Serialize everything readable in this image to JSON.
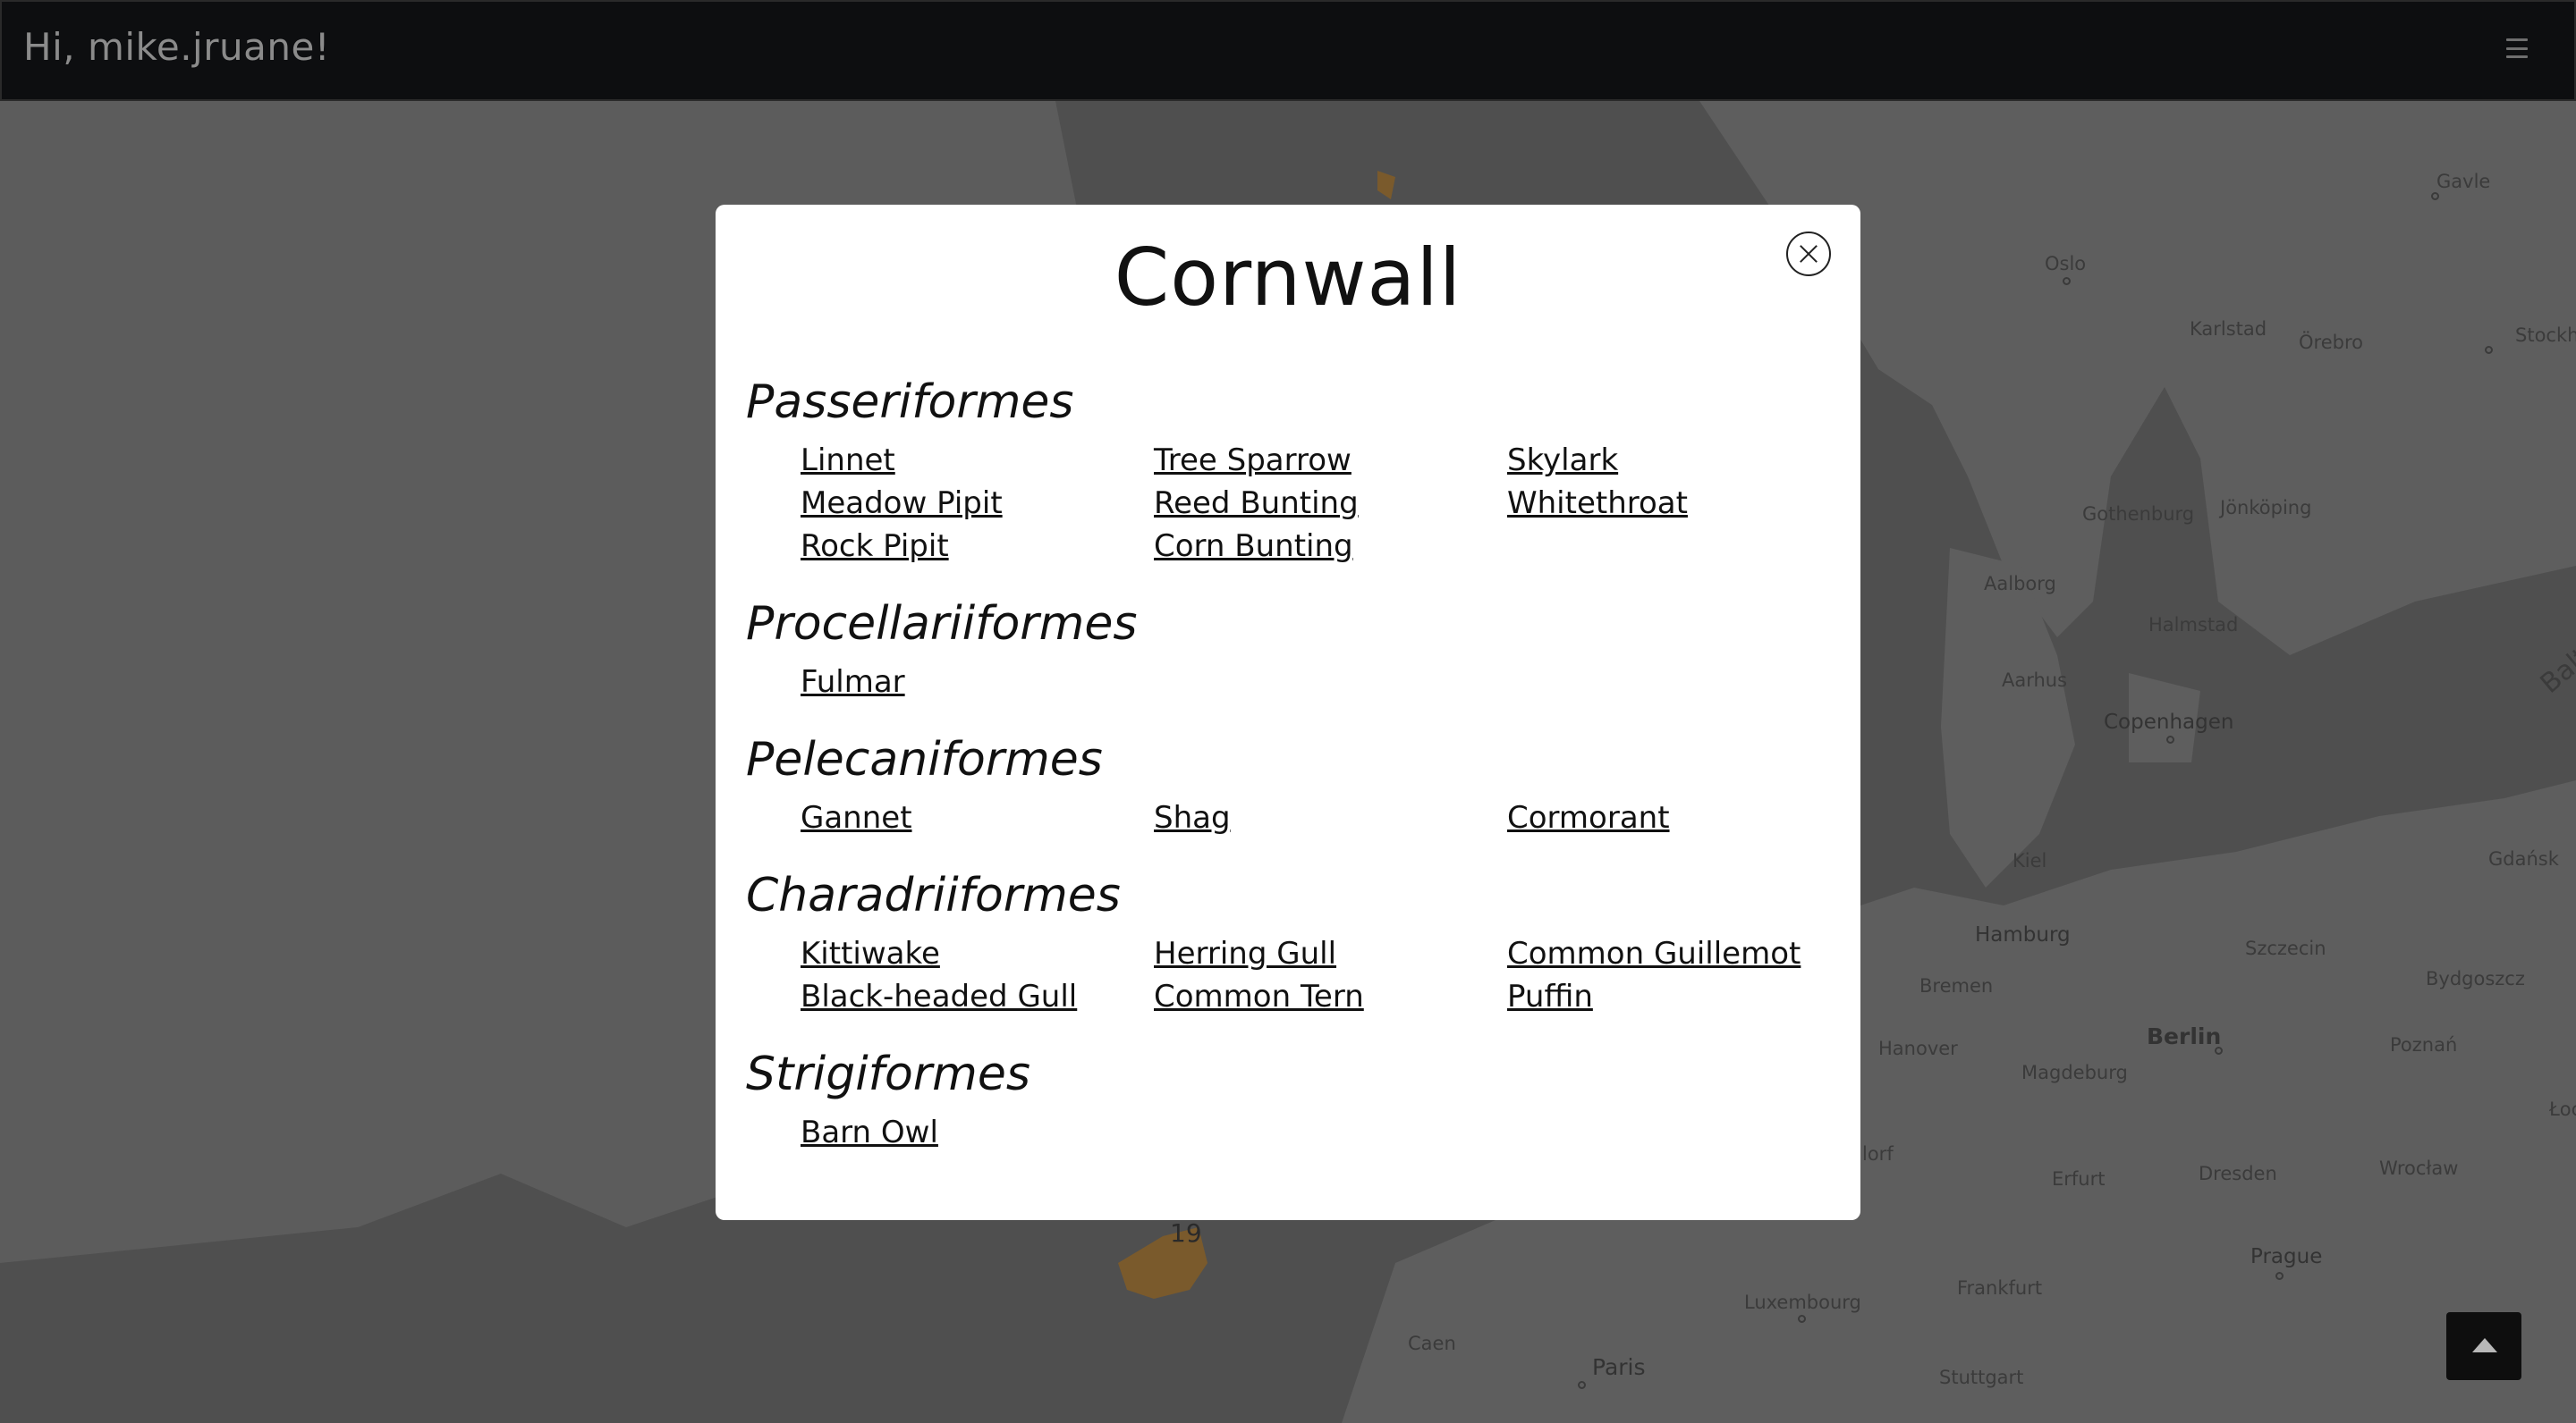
{
  "header": {
    "greeting": "Hi, mike.jruane!",
    "menu_icon": "hamburger-menu-icon"
  },
  "map": {
    "labels": [
      {
        "name": "Gavle",
        "text": "Gavle"
      },
      {
        "name": "Oslo",
        "text": "Oslo"
      },
      {
        "name": "Karlstad",
        "text": "Karlstad"
      },
      {
        "name": "Orebro",
        "text": "Örebro"
      },
      {
        "name": "Stockholm",
        "text": "Stockho"
      },
      {
        "name": "Gothenburg",
        "text": "Gothenburg"
      },
      {
        "name": "Jonkoping",
        "text": "Jönköping"
      },
      {
        "name": "Aalborg",
        "text": "Aalborg"
      },
      {
        "name": "Halmstad",
        "text": "Halmstad"
      },
      {
        "name": "Aarhus",
        "text": "Aarhus"
      },
      {
        "name": "Copenhagen",
        "text": "Copenhagen"
      },
      {
        "name": "Baltic",
        "text": "Balt"
      },
      {
        "name": "Kiel",
        "text": "Kiel"
      },
      {
        "name": "Gdansk",
        "text": "Gdańsk"
      },
      {
        "name": "Hamburg",
        "text": "Hamburg"
      },
      {
        "name": "Szczecin",
        "text": "Szczecin"
      },
      {
        "name": "Bremen",
        "text": "Bremen"
      },
      {
        "name": "Bydgoszcz",
        "text": "Bydgoszcz"
      },
      {
        "name": "Berlin",
        "text": "Berlin"
      },
      {
        "name": "Hanover",
        "text": "Hanover"
      },
      {
        "name": "Magdeburg",
        "text": "Magdeburg"
      },
      {
        "name": "Poznan",
        "text": "Poznań"
      },
      {
        "name": "Lodz",
        "text": "Łoc"
      },
      {
        "name": "Dusseldorf",
        "text": "lorf"
      },
      {
        "name": "Erfurt",
        "text": "Erfurt"
      },
      {
        "name": "Dresden",
        "text": "Dresden"
      },
      {
        "name": "Wroclaw",
        "text": "Wrocław"
      },
      {
        "name": "Prague",
        "text": "Prague"
      },
      {
        "name": "Luxembourg",
        "text": "Luxembourg"
      },
      {
        "name": "Frankfurt",
        "text": "Frankfurt"
      },
      {
        "name": "Caen",
        "text": "Caen"
      },
      {
        "name": "Paris",
        "text": "Paris"
      },
      {
        "name": "Stuttgart",
        "text": "Stuttgart"
      }
    ],
    "region_marker_count": "19"
  },
  "modal": {
    "title": "Cornwall",
    "close_icon": "close-circle-icon",
    "orders": [
      {
        "name": "Passeriformes",
        "species": [
          "Linnet",
          "Tree Sparrow",
          "Skylark",
          "Meadow Pipit",
          "Reed Bunting",
          "Whitethroat",
          "Rock Pipit",
          "Corn Bunting"
        ]
      },
      {
        "name": "Procellariiformes",
        "species": [
          "Fulmar"
        ]
      },
      {
        "name": "Pelecaniformes",
        "species": [
          "Gannet",
          "Shag",
          "Cormorant"
        ]
      },
      {
        "name": "Charadriiformes",
        "species": [
          "Kittiwake",
          "Herring Gull",
          "Common Guillemot",
          "Black-headed Gull",
          "Common Tern",
          "Puffin"
        ]
      },
      {
        "name": "Strigiformes",
        "species": [
          "Barn Owl"
        ]
      }
    ]
  },
  "scroll_top": {
    "icon": "triangle-up-icon"
  }
}
